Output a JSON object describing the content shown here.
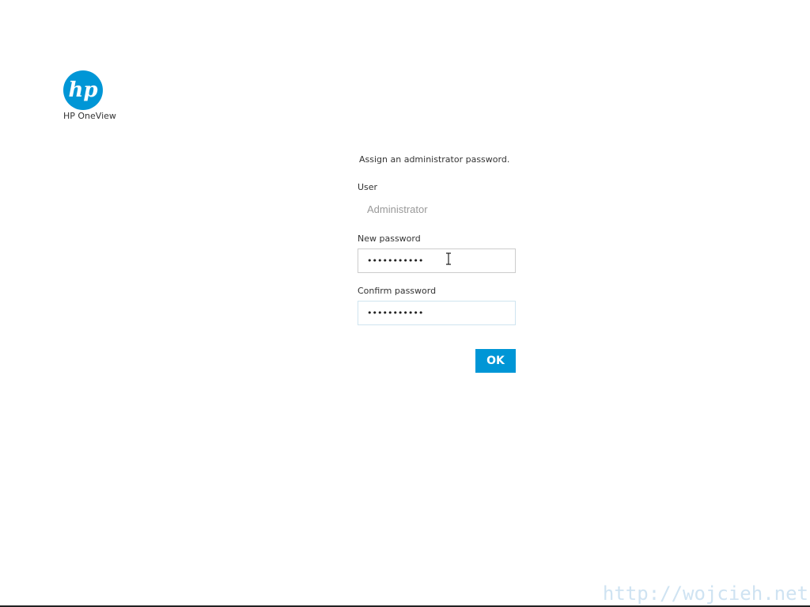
{
  "app": {
    "product_name": "HP OneView",
    "logo_icon": "hp-logo",
    "brand_color": "#0096d6"
  },
  "form": {
    "prompt": "Assign an administrator password.",
    "user_label": "User",
    "user_value": "Administrator",
    "new_password_label": "New password",
    "new_password_value": "•••••••••••",
    "confirm_password_label": "Confirm password",
    "confirm_password_value": "•••••••••••",
    "ok_label": "OK"
  },
  "watermark": {
    "text": "http://wojcieh.net"
  }
}
